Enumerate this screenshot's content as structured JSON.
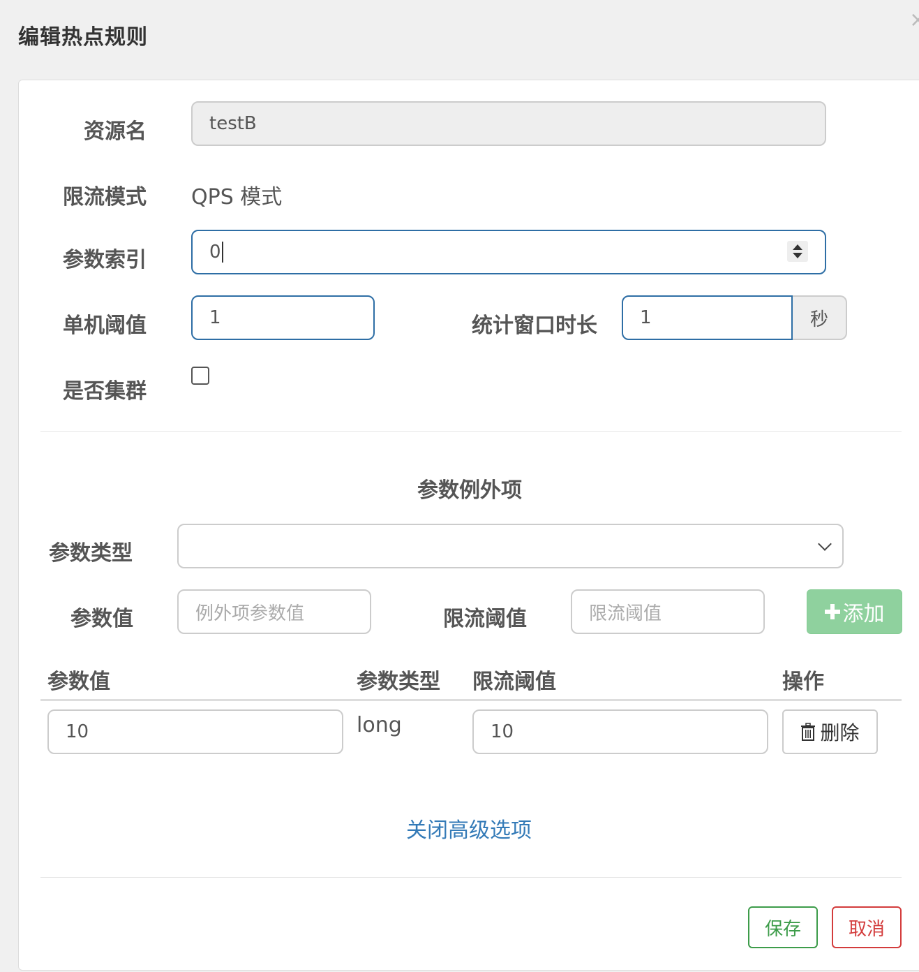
{
  "dialog": {
    "title": "编辑热点规则",
    "close_glyph": "×"
  },
  "form": {
    "resource": {
      "label": "资源名",
      "value": "testB"
    },
    "mode": {
      "label": "限流模式",
      "value": "QPS 模式"
    },
    "param_index": {
      "label": "参数索引",
      "value": "0"
    },
    "threshold": {
      "label": "单机阈值",
      "value": "1"
    },
    "window": {
      "label": "统计窗口时长",
      "value": "1",
      "unit": "秒"
    },
    "cluster": {
      "label": "是否集群",
      "checked": false
    }
  },
  "exceptions": {
    "title": "参数例外项",
    "param_type_label": "参数类型",
    "param_type_value": "",
    "param_value_label": "参数值",
    "param_value_placeholder": "例外项参数值",
    "limit_label": "限流阈值",
    "limit_placeholder": "限流阈值",
    "add_button": "添加",
    "table": {
      "headers": [
        "参数值",
        "参数类型",
        "限流阈值",
        "操作"
      ],
      "rows": [
        {
          "param_value": "10",
          "param_type": "long",
          "limit": "10",
          "action": "删除"
        }
      ]
    }
  },
  "toggle_link": "关闭高级选项",
  "footer": {
    "save": "保存",
    "cancel": "取消"
  }
}
